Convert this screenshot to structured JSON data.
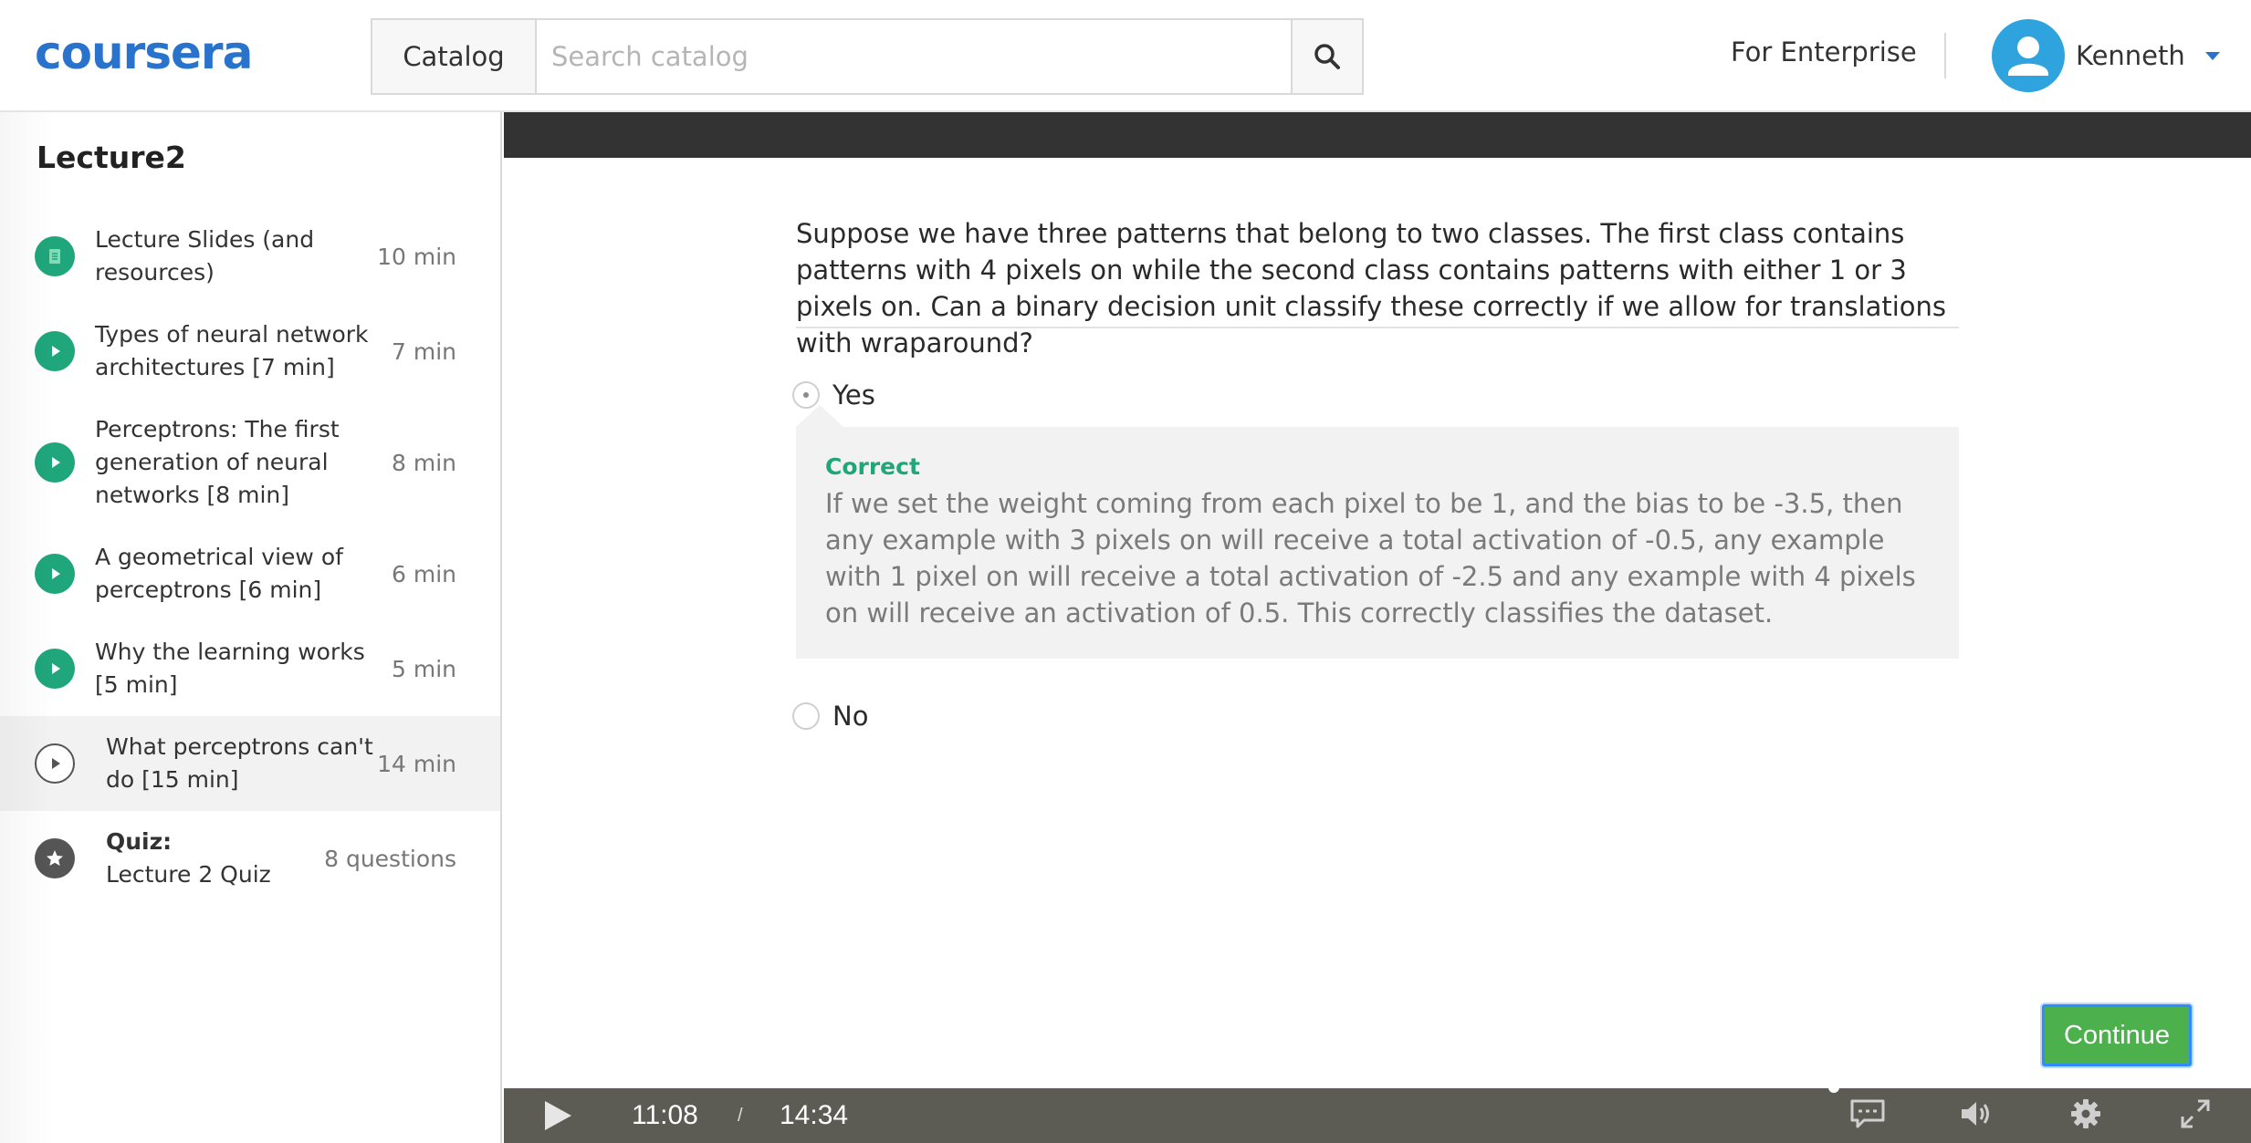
{
  "header": {
    "logo": "coursera",
    "catalog_label": "Catalog",
    "search_placeholder": "Search catalog",
    "search_icon": "search-icon",
    "enterprise_label": "For Enterprise",
    "user_name": "Kenneth",
    "brand_color": "#2a73cc"
  },
  "sidebar": {
    "title": "Lecture2",
    "items": [
      {
        "label": "Lecture Slides (and resources)",
        "duration": "10 min",
        "icon": "document-icon",
        "status": "completed"
      },
      {
        "label": "Types of neural network architectures [7 min]",
        "duration": "7 min",
        "icon": "play-icon",
        "status": "completed"
      },
      {
        "label": "Perceptrons: The first generation of neural networks [8 min]",
        "duration": "8 min",
        "icon": "play-icon",
        "status": "completed"
      },
      {
        "label": "A geometrical view of perceptrons [6 min]",
        "duration": "6 min",
        "icon": "play-icon",
        "status": "completed"
      },
      {
        "label": "Why the learning works [5 min]",
        "duration": "5 min",
        "icon": "play-icon",
        "status": "completed"
      },
      {
        "label": "What perceptrons can't do [15 min]",
        "duration": "14 min",
        "icon": "play-outline-icon",
        "status": "active"
      },
      {
        "label_type": "Quiz:",
        "label": "Lecture 2 Quiz",
        "duration": "8 questions",
        "icon": "star-icon",
        "status": "pending"
      }
    ]
  },
  "quiz": {
    "question": "Suppose we have three patterns that belong to two classes. The first class contains patterns with 4 pixels on while the second class contains patterns with either 1 or 3 pixels on. Can a binary decision unit classify these correctly if we allow for translations with wraparound?",
    "options": [
      {
        "label": "Yes",
        "selected": true
      },
      {
        "label": "No",
        "selected": false
      }
    ],
    "feedback_title": "Correct",
    "feedback_text": "If we set the weight coming from each pixel to be 1, and the bias to be -3.5, then any example with 3 pixels on will receive a total activation of -0.5, any example with 1 pixel on will receive a total activation of -2.5 and any example with 4 pixels on will receive an activation of 0.5. This correctly classifies the dataset.",
    "continue_label": "Continue",
    "correct_color": "#1fa67a"
  },
  "player": {
    "current_time": "11:08",
    "separator": "/",
    "total_time": "14:34",
    "controls": [
      "play-icon",
      "captions-icon",
      "volume-icon",
      "settings-icon",
      "fullscreen-icon"
    ]
  }
}
